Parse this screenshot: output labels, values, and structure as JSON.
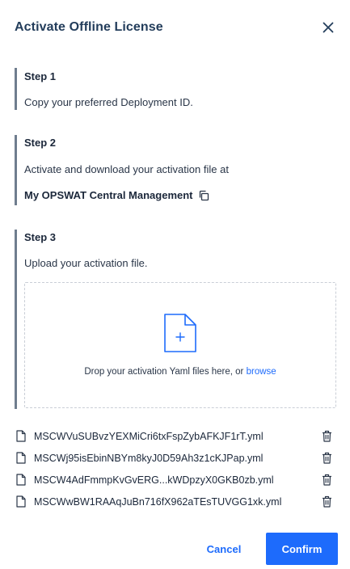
{
  "dialog": {
    "title": "Activate Offline License"
  },
  "steps": [
    {
      "title": "Step 1",
      "text": "Copy your preferred Deployment ID."
    },
    {
      "title": "Step 2",
      "text": "Activate and download your activation file at",
      "link": "My OPSWAT Central Management"
    },
    {
      "title": "Step 3",
      "text": "Upload your activation file."
    }
  ],
  "dropzone": {
    "text": "Drop your activation Yaml files here, or",
    "browse": "browse"
  },
  "files": [
    "MSCWVuSUBvzYEXMiCri6txFspZybAFKJF1rT.yml",
    "MSCWj95isEbinNBYm8kyJ0D59Ah3z1cKJPap.yml",
    "MSCW4AdFmmpKvGvERG...kWDpzyX0GKB0zb.yml",
    "MSCWwBW1RAAqJuBn716fX962aTEsTUVGG1xk.yml"
  ],
  "footer": {
    "cancel": "Cancel",
    "confirm": "Confirm"
  },
  "colors": {
    "accent": "#1d6bfc",
    "title": "#233d5b",
    "step_border": "#6f7d8e"
  },
  "icons": {
    "close": "close-icon",
    "copy": "copy-icon",
    "file_upload": "file-upload-icon",
    "file": "file-icon",
    "trash": "trash-icon"
  }
}
